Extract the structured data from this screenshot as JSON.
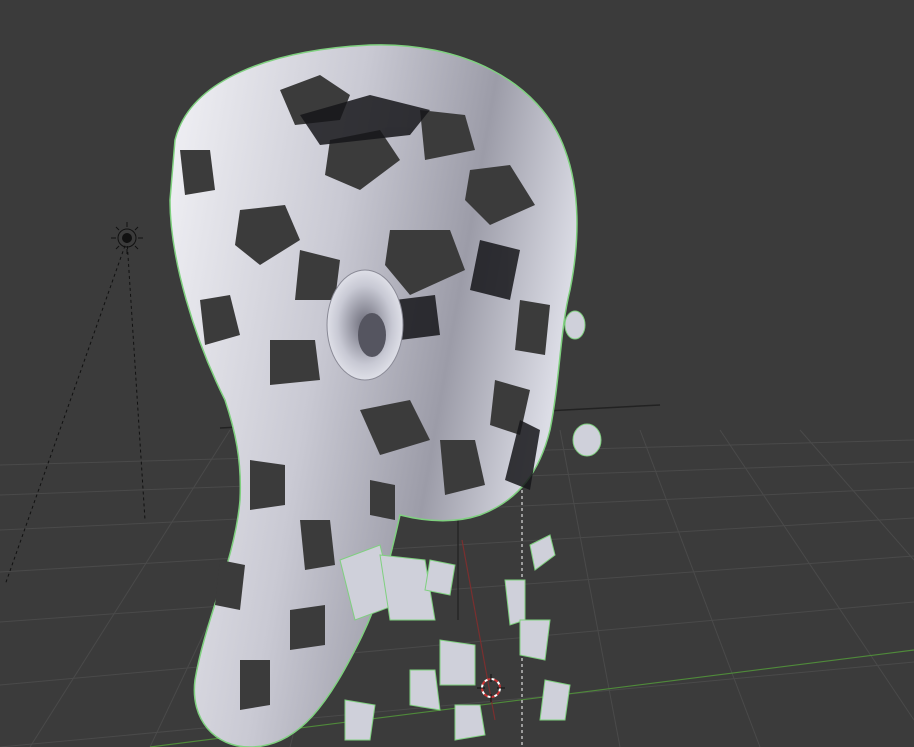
{
  "viewport": {
    "view": "perspective-3d",
    "background_color": "#3b3b3b",
    "grid_color": "#4a4a4a",
    "x_axis_color": "#7a2f2f",
    "y_axis_color": "#4f8a3a",
    "selection_outline_color": "#7fd07f"
  },
  "scene": {
    "objects": [
      {
        "name_icon": "head-mesh",
        "selected": true,
        "shading": "solid-matcap-cutout"
      },
      {
        "name_icon": "lamp-icon",
        "selected": false
      },
      {
        "name_icon": "camera-icon",
        "selected": false
      }
    ],
    "cursor_icon": "3d-cursor-icon"
  }
}
